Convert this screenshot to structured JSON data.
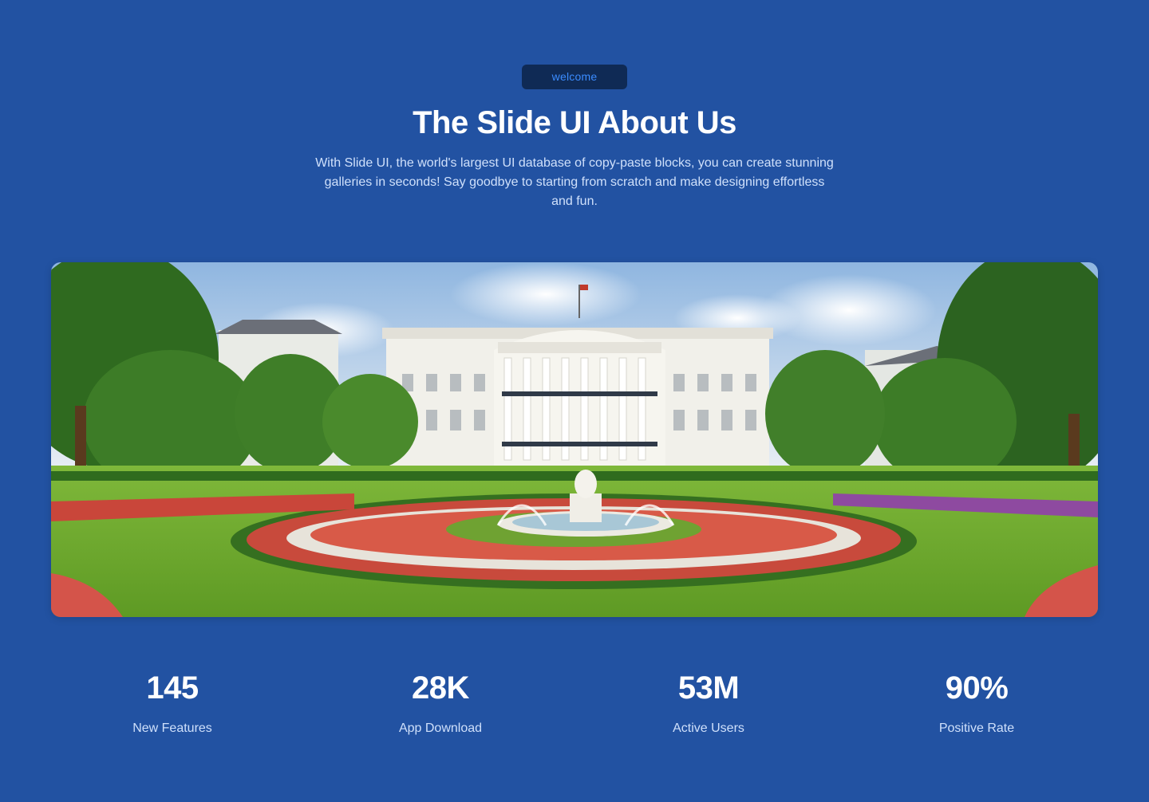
{
  "header": {
    "badge": "welcome",
    "title": "The Slide UI About Us",
    "description": "With Slide UI, the world's largest UI database of copy-paste blocks, you can create stunning galleries in seconds! Say goodbye to starting from scratch and make designing effortless and fun."
  },
  "hero_image": {
    "subject": "white-house-garden-fountain-image"
  },
  "stats": [
    {
      "value": "145",
      "label": "New Features"
    },
    {
      "value": "28K",
      "label": "App Download"
    },
    {
      "value": "53M",
      "label": "Active Users"
    },
    {
      "value": "90%",
      "label": "Positive Rate"
    }
  ],
  "colors": {
    "background": "#2252a2",
    "badge_bg": "#0f2a55",
    "badge_text": "#3b8cff",
    "text": "#ffffff",
    "muted_text": "#cfe0fb"
  }
}
